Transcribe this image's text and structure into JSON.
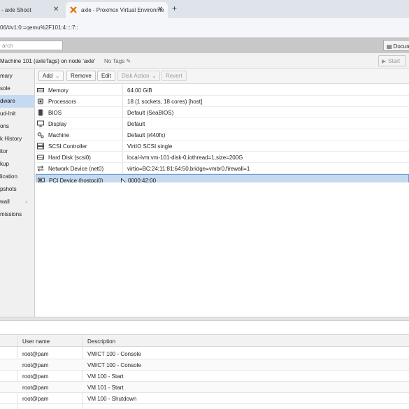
{
  "browser": {
    "tabs": [
      {
        "label": "- axle Shoot"
      },
      {
        "label": "axle - Proxmox Virtual Environme"
      }
    ],
    "url": "06/#v1:0:=qemu%2F101:4::::7::"
  },
  "pve": {
    "search_placeholder": "arch",
    "doc_button": "Docum"
  },
  "vm": {
    "title": "Machine 101 (axleTags) on node 'axle'",
    "tags": "No Tags",
    "start_label": "Start"
  },
  "nav": {
    "items": [
      {
        "label": "mary"
      },
      {
        "label": "sole"
      },
      {
        "label": "dware"
      },
      {
        "label": "ud-Init"
      },
      {
        "label": "ons"
      },
      {
        "label": "k History"
      },
      {
        "label": "itor"
      },
      {
        "label": "kup"
      },
      {
        "label": "lication"
      },
      {
        "label": "pshots"
      },
      {
        "label": "wall"
      },
      {
        "label": "missions"
      }
    ]
  },
  "toolbar": {
    "add": "Add",
    "remove": "Remove",
    "edit": "Edit",
    "disk_action": "Disk Action",
    "revert": "Revert"
  },
  "hardware": [
    {
      "name": "Memory",
      "value": "64.00 GiB",
      "icon": "memory-icon"
    },
    {
      "name": "Processors",
      "value": "18 (1 sockets, 18 cores) [host]",
      "icon": "cpu-icon"
    },
    {
      "name": "BIOS",
      "value": "Default (SeaBIOS)",
      "icon": "bios-icon"
    },
    {
      "name": "Display",
      "value": "Default",
      "icon": "display-icon"
    },
    {
      "name": "Machine",
      "value": "Default (i440fx)",
      "icon": "machine-icon"
    },
    {
      "name": "SCSI Controller",
      "value": "VirtIO SCSI single",
      "icon": "scsi-icon"
    },
    {
      "name": "Hard Disk (scsi0)",
      "value": "local-lvm:vm-101-disk-0,iothread=1,size=200G",
      "icon": "harddisk-icon"
    },
    {
      "name": "Network Device (net0)",
      "value": "virtio=BC:24:11:81:64:50,bridge=vmbr0,firewall=1",
      "icon": "network-icon"
    },
    {
      "name": "PCI Device (hostpci0)",
      "value": "0000:42:00",
      "icon": "pci-icon"
    }
  ],
  "tasks": {
    "headers": {
      "user": "User name",
      "description": "Description"
    },
    "rows": [
      {
        "user": "root@pam",
        "description": "VM/CT 100 - Console"
      },
      {
        "user": "root@pam",
        "description": "VM/CT 100 - Console"
      },
      {
        "user": "root@pam",
        "description": "VM 100 - Start"
      },
      {
        "user": "root@pam",
        "description": "VM 101 - Start"
      },
      {
        "user": "root@pam",
        "description": "VM 100 - Shutdown"
      }
    ]
  }
}
